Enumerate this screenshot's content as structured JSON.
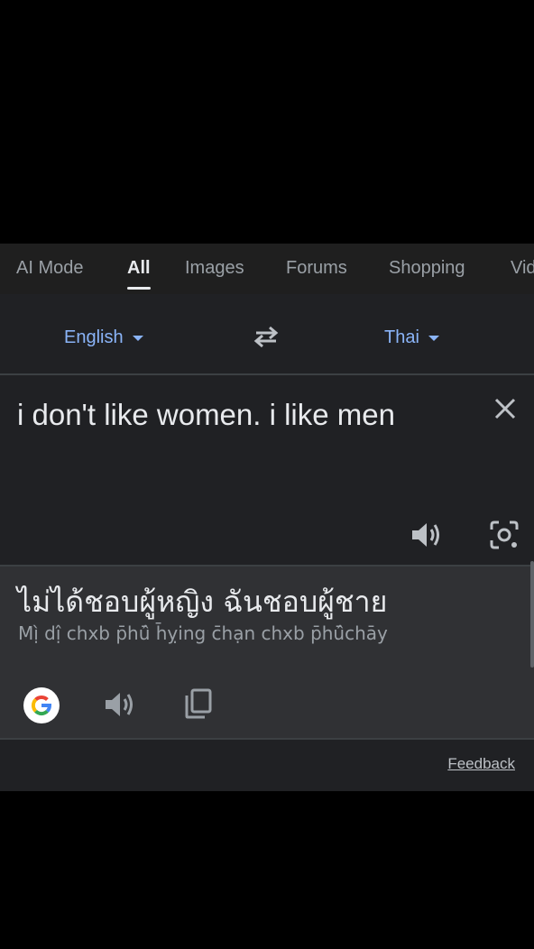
{
  "tabs": {
    "items": [
      "AI Mode",
      "All",
      "Images",
      "Forums",
      "Shopping",
      "Vid"
    ],
    "active": "All"
  },
  "languages": {
    "source": "English",
    "target": "Thai"
  },
  "source": {
    "text": "i don't like women. i like men"
  },
  "result": {
    "translation": "ไม่ได้ชอบผู้หญิง ฉันชอบผู้ชาย",
    "transliteration": "Mị̀ dị̂ chxb p̄hū̂ h̄ỵing c̄hạn chxb p̄hū̂chāy"
  },
  "footer": {
    "feedback_label": "Feedback"
  },
  "icons": {
    "swap": "swap-arrows-icon",
    "clear": "close-icon",
    "speak": "speaker-icon",
    "lens": "camera-lens-icon",
    "google": "google-g-logo",
    "copy": "copy-icon"
  },
  "colors": {
    "background": "#000000",
    "panel": "#202124",
    "result_panel": "#303134",
    "accent": "#8ab4f8",
    "text_primary": "#e8eaed",
    "text_secondary": "#9aa0a6"
  }
}
